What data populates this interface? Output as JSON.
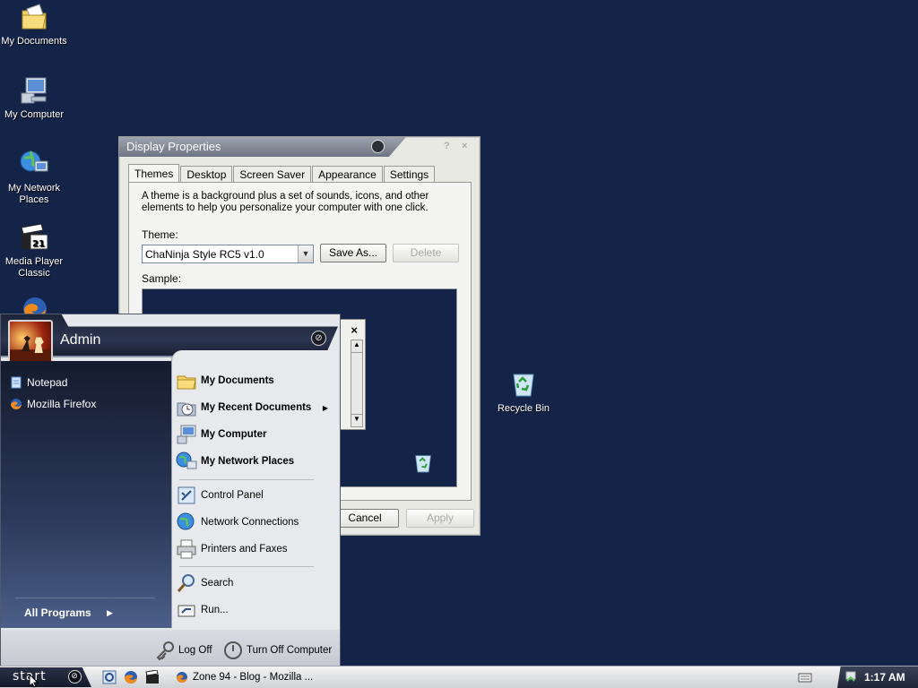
{
  "desktop": {
    "icons": [
      {
        "label": "My Documents"
      },
      {
        "label": "My Computer"
      },
      {
        "label": "My Network Places"
      },
      {
        "label": "Media Player Classic"
      },
      {
        "label": "Recycle Bin"
      }
    ]
  },
  "display_properties": {
    "title": "Display Properties",
    "help": "?",
    "close": "×",
    "tabs": [
      {
        "label": "Themes",
        "active": true
      },
      {
        "label": "Desktop"
      },
      {
        "label": "Screen Saver"
      },
      {
        "label": "Appearance"
      },
      {
        "label": "Settings"
      }
    ],
    "description": "A theme is a background plus a set of sounds, icons, and other elements to help you personalize your computer with one click.",
    "theme_label": "Theme:",
    "theme_value": "ChaNinja Style RC5 v1.0",
    "save_as": "Save As...",
    "delete": "Delete",
    "sample_label": "Sample:",
    "cancel": "Cancel",
    "apply": "Apply",
    "sample_close": "×"
  },
  "start_menu": {
    "user": "Admin",
    "pinned": [
      {
        "label": "Notepad"
      },
      {
        "label": "Mozilla Firefox"
      }
    ],
    "all_programs": "All Programs",
    "places": [
      {
        "label": "My Documents"
      },
      {
        "label": "My Recent Documents"
      },
      {
        "label": "My Computer"
      },
      {
        "label": "My Network Places"
      }
    ],
    "system": [
      {
        "label": "Control Panel"
      },
      {
        "label": "Network Connections"
      },
      {
        "label": "Printers and Faxes"
      }
    ],
    "tools": [
      {
        "label": "Search"
      },
      {
        "label": "Run..."
      }
    ],
    "log_off": "Log Off",
    "turn_off": "Turn Off Computer"
  },
  "taskbar": {
    "start_label": "start",
    "task": "Zone 94 - Blog - Mozilla ...",
    "clock": "1:17 AM"
  },
  "colors": {
    "desktop_bg": "#142449",
    "start_menu_dark": "#1d2438"
  }
}
